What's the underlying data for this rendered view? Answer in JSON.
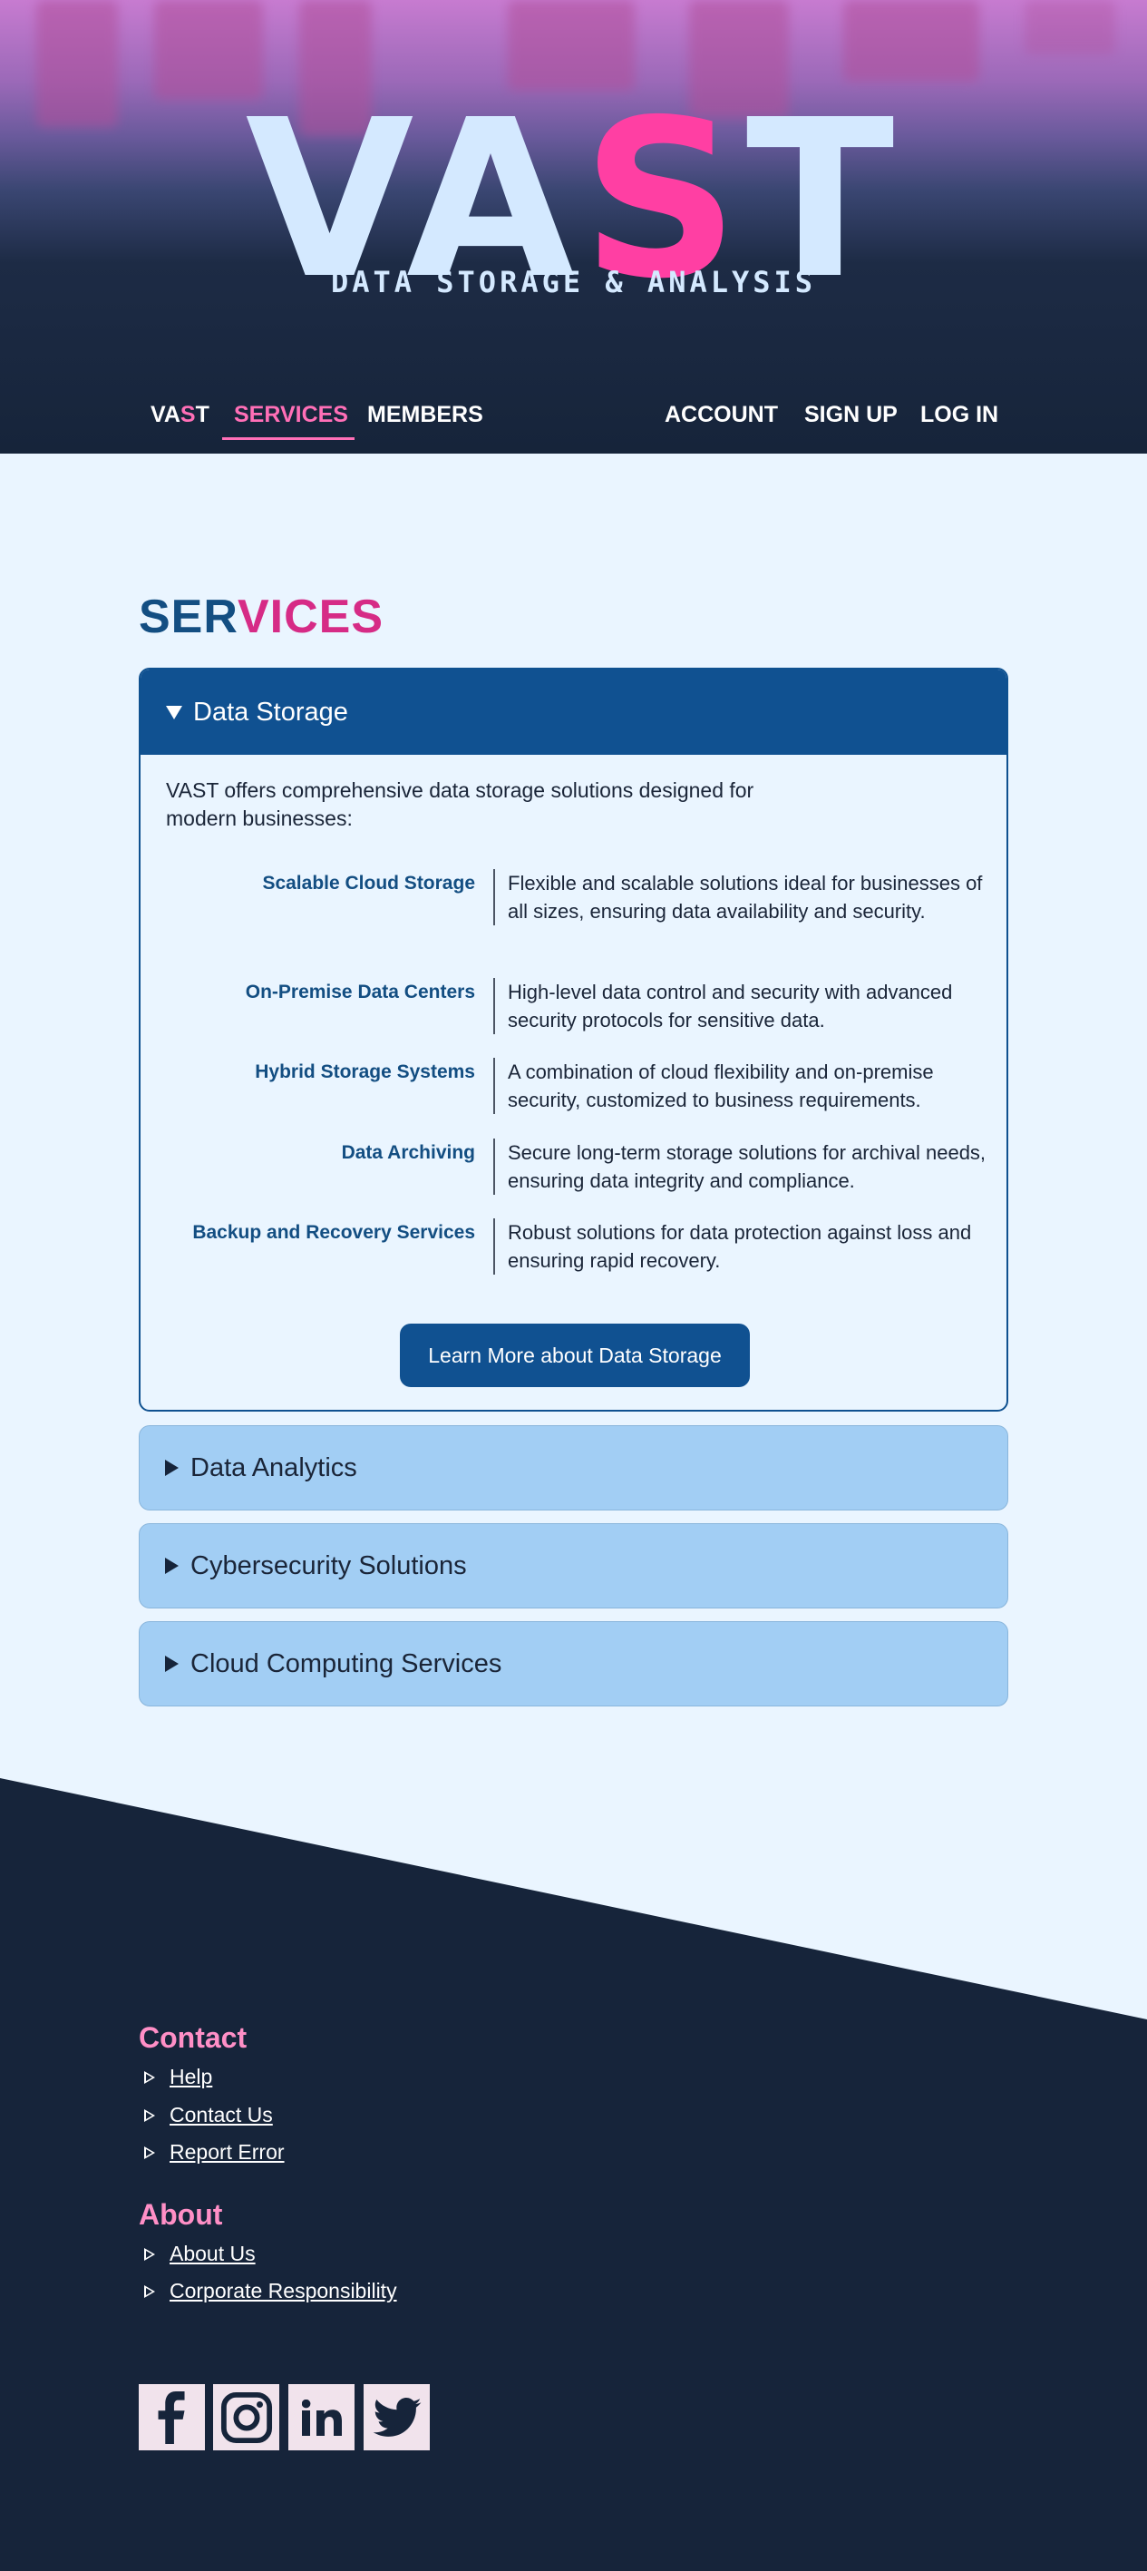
{
  "header": {
    "logo": {
      "before": "VA",
      "accent": "S",
      "after": "T"
    },
    "tagline": "DATA STORAGE & ANALYSIS"
  },
  "nav": {
    "brand": {
      "before": "VA",
      "accent": "S",
      "after": "T"
    },
    "left": [
      "SERVICES",
      "MEMBERS"
    ],
    "right": [
      "ACCOUNT",
      "SIGN UP",
      "LOG IN"
    ],
    "active": "SERVICES"
  },
  "services": {
    "title_part1": "SER",
    "title_part2": "VICES",
    "open_panel": {
      "label": "Data Storage",
      "intro": "VAST offers comprehensive data storage solutions designed for modern businesses:",
      "items": [
        {
          "term": "Scalable Cloud Storage",
          "desc": "Flexible and scalable solutions ideal for businesses of all sizes, ensuring data availability and security."
        },
        {
          "term": "On-Premise Data Centers",
          "desc": "High-level data control and security with advanced security protocols for sensitive data."
        },
        {
          "term": "Hybrid Storage Systems",
          "desc": "A combination of cloud flexibility and on-premise security, customized to business requirements."
        },
        {
          "term": "Data Archiving",
          "desc": "Secure long-term storage solutions for archival needs, ensuring data integrity and compliance."
        },
        {
          "term": "Backup and Recovery Services",
          "desc": "Robust solutions for data protection against loss and ensuring rapid recovery."
        }
      ],
      "button": "Learn More about Data Storage"
    },
    "closed_panels": [
      "Data Analytics",
      "Cybersecurity Solutions",
      "Cloud Computing Services"
    ]
  },
  "footer": {
    "contact": {
      "heading": "Contact",
      "links": [
        "Help",
        "Contact Us",
        "Report Error"
      ]
    },
    "about": {
      "heading": "About",
      "links": [
        "About Us",
        "Corporate Responsibility"
      ]
    },
    "social": [
      "facebook-icon",
      "instagram-icon",
      "linkedin-icon",
      "twitter-icon"
    ]
  },
  "colors": {
    "navy": "#16243a",
    "brand_blue": "#105191",
    "pink": "#ff3fa3",
    "light_bg": "#eaf5ff",
    "closed_panel": "#a2cef4"
  }
}
